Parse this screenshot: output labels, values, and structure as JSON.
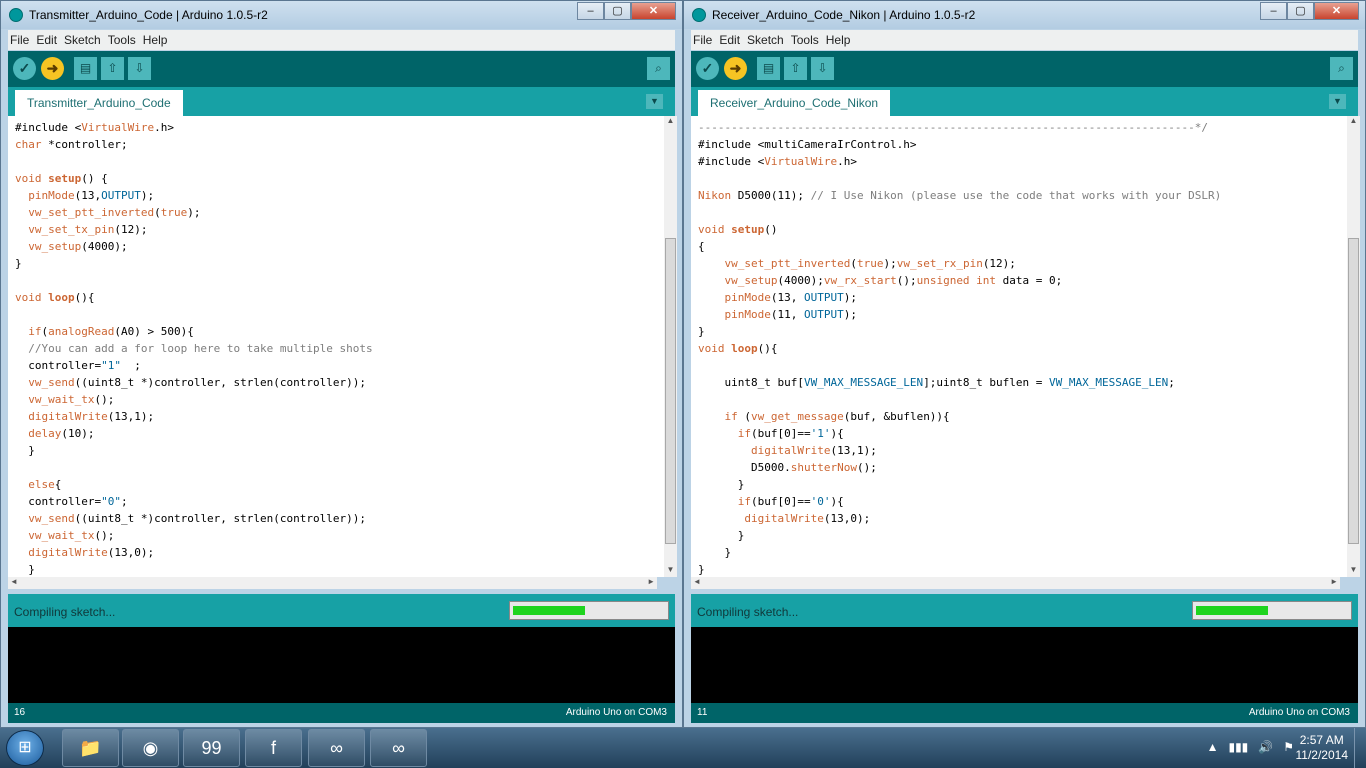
{
  "windows": [
    {
      "title": "Transmitter_Arduino_Code | Arduino 1.0.5-r2",
      "menu": [
        "File",
        "Edit",
        "Sketch",
        "Tools",
        "Help"
      ],
      "tab": "Transmitter_Arduino_Code",
      "status": "Compiling sketch...",
      "progress": 0.48,
      "line_number": "16",
      "board": "Arduino Uno on COM3",
      "code": [
        [
          {
            "t": "#include <"
          },
          {
            "t": "VirtualWire",
            "c": "c-kw"
          },
          {
            "t": ".h>"
          }
        ],
        [
          {
            "t": "char",
            "c": "c-kw"
          },
          {
            "t": " *controller;"
          }
        ],
        [
          {
            "t": ""
          }
        ],
        [
          {
            "t": "void",
            "c": "c-kw"
          },
          {
            "t": " "
          },
          {
            "t": "setup",
            "c": "c-bold"
          },
          {
            "t": "() {"
          }
        ],
        [
          {
            "t": "  "
          },
          {
            "t": "pinMode",
            "c": "c-func"
          },
          {
            "t": "(13,"
          },
          {
            "t": "OUTPUT",
            "c": "c-const"
          },
          {
            "t": ");"
          }
        ],
        [
          {
            "t": "  "
          },
          {
            "t": "vw_set_ptt_inverted",
            "c": "c-func"
          },
          {
            "t": "("
          },
          {
            "t": "true",
            "c": "c-kw"
          },
          {
            "t": ");"
          }
        ],
        [
          {
            "t": "  "
          },
          {
            "t": "vw_set_tx_pin",
            "c": "c-func"
          },
          {
            "t": "(12);"
          }
        ],
        [
          {
            "t": "  "
          },
          {
            "t": "vw_setup",
            "c": "c-func"
          },
          {
            "t": "(4000);"
          }
        ],
        [
          {
            "t": "}"
          }
        ],
        [
          {
            "t": ""
          }
        ],
        [
          {
            "t": "void",
            "c": "c-kw"
          },
          {
            "t": " "
          },
          {
            "t": "loop",
            "c": "c-bold"
          },
          {
            "t": "(){"
          }
        ],
        [
          {
            "t": ""
          }
        ],
        [
          {
            "t": "  "
          },
          {
            "t": "if",
            "c": "c-kw"
          },
          {
            "t": "("
          },
          {
            "t": "analogRead",
            "c": "c-func"
          },
          {
            "t": "(A0) > 500){"
          }
        ],
        [
          {
            "t": "  "
          },
          {
            "t": "//You can add a for loop here to take multiple shots",
            "c": "c-comment"
          }
        ],
        [
          {
            "t": "  controller="
          },
          {
            "t": "\"1\"",
            "c": "c-str"
          },
          {
            "t": "  ;"
          }
        ],
        [
          {
            "t": "  "
          },
          {
            "t": "vw_send",
            "c": "c-func"
          },
          {
            "t": "((uint8_t *)controller, strlen(controller));"
          }
        ],
        [
          {
            "t": "  "
          },
          {
            "t": "vw_wait_tx",
            "c": "c-func"
          },
          {
            "t": "();"
          }
        ],
        [
          {
            "t": "  "
          },
          {
            "t": "digitalWrite",
            "c": "c-func"
          },
          {
            "t": "(13,1);"
          }
        ],
        [
          {
            "t": "  "
          },
          {
            "t": "delay",
            "c": "c-func"
          },
          {
            "t": "(10);"
          }
        ],
        [
          {
            "t": "  }"
          }
        ],
        [
          {
            "t": ""
          }
        ],
        [
          {
            "t": "  "
          },
          {
            "t": "else",
            "c": "c-kw"
          },
          {
            "t": "{"
          }
        ],
        [
          {
            "t": "  controller="
          },
          {
            "t": "\"0\"",
            "c": "c-str"
          },
          {
            "t": ";"
          }
        ],
        [
          {
            "t": "  "
          },
          {
            "t": "vw_send",
            "c": "c-func"
          },
          {
            "t": "((uint8_t *)controller, strlen(controller));"
          }
        ],
        [
          {
            "t": "  "
          },
          {
            "t": "vw_wait_tx",
            "c": "c-func"
          },
          {
            "t": "();"
          }
        ],
        [
          {
            "t": "  "
          },
          {
            "t": "digitalWrite",
            "c": "c-func"
          },
          {
            "t": "(13,0);"
          }
        ],
        [
          {
            "t": "  }"
          }
        ]
      ]
    },
    {
      "title": "Receiver_Arduino_Code_Nikon | Arduino 1.0.5-r2",
      "menu": [
        "File",
        "Edit",
        "Sketch",
        "Tools",
        "Help"
      ],
      "tab": "Receiver_Arduino_Code_Nikon",
      "status": "Compiling sketch...",
      "progress": 0.48,
      "line_number": "11",
      "board": "Arduino Uno on COM3",
      "code": [
        [
          {
            "t": "---------------------------------------------------------------------------*/",
            "c": "c-comment"
          }
        ],
        [
          {
            "t": "#include <multiCameraIrControl.h>"
          }
        ],
        [
          {
            "t": "#include <"
          },
          {
            "t": "VirtualWire",
            "c": "c-kw"
          },
          {
            "t": ".h>"
          }
        ],
        [
          {
            "t": ""
          }
        ],
        [
          {
            "t": "Nikon",
            "c": "c-kw"
          },
          {
            "t": " D5000(11); "
          },
          {
            "t": "// I Use Nikon (please use the code that works with your DSLR)",
            "c": "c-comment"
          }
        ],
        [
          {
            "t": ""
          }
        ],
        [
          {
            "t": "void",
            "c": "c-kw"
          },
          {
            "t": " "
          },
          {
            "t": "setup",
            "c": "c-bold"
          },
          {
            "t": "()"
          }
        ],
        [
          {
            "t": "{"
          }
        ],
        [
          {
            "t": "    "
          },
          {
            "t": "vw_set_ptt_inverted",
            "c": "c-func"
          },
          {
            "t": "("
          },
          {
            "t": "true",
            "c": "c-kw"
          },
          {
            "t": ");"
          },
          {
            "t": "vw_set_rx_pin",
            "c": "c-func"
          },
          {
            "t": "(12);"
          }
        ],
        [
          {
            "t": "    "
          },
          {
            "t": "vw_setup",
            "c": "c-func"
          },
          {
            "t": "(4000);"
          },
          {
            "t": "vw_rx_start",
            "c": "c-func"
          },
          {
            "t": "();"
          },
          {
            "t": "unsigned int",
            "c": "c-kw"
          },
          {
            "t": " data = 0;"
          }
        ],
        [
          {
            "t": "    "
          },
          {
            "t": "pinMode",
            "c": "c-func"
          },
          {
            "t": "(13, "
          },
          {
            "t": "OUTPUT",
            "c": "c-const"
          },
          {
            "t": ");"
          }
        ],
        [
          {
            "t": "    "
          },
          {
            "t": "pinMode",
            "c": "c-func"
          },
          {
            "t": "(11, "
          },
          {
            "t": "OUTPUT",
            "c": "c-const"
          },
          {
            "t": ");"
          }
        ],
        [
          {
            "t": "}"
          }
        ],
        [
          {
            "t": "void",
            "c": "c-kw"
          },
          {
            "t": " "
          },
          {
            "t": "loop",
            "c": "c-bold"
          },
          {
            "t": "(){"
          }
        ],
        [
          {
            "t": ""
          }
        ],
        [
          {
            "t": "    uint8_t buf["
          },
          {
            "t": "VW_MAX_MESSAGE_LEN",
            "c": "c-const"
          },
          {
            "t": "];uint8_t buflen = "
          },
          {
            "t": "VW_MAX_MESSAGE_LEN",
            "c": "c-const"
          },
          {
            "t": ";"
          }
        ],
        [
          {
            "t": ""
          }
        ],
        [
          {
            "t": "    "
          },
          {
            "t": "if",
            "c": "c-kw"
          },
          {
            "t": " ("
          },
          {
            "t": "vw_get_message",
            "c": "c-func"
          },
          {
            "t": "(buf, &buflen)){"
          }
        ],
        [
          {
            "t": "      "
          },
          {
            "t": "if",
            "c": "c-kw"
          },
          {
            "t": "(buf[0]=="
          },
          {
            "t": "'1'",
            "c": "c-str"
          },
          {
            "t": "){"
          }
        ],
        [
          {
            "t": "        "
          },
          {
            "t": "digitalWrite",
            "c": "c-func"
          },
          {
            "t": "(13,1);"
          }
        ],
        [
          {
            "t": "        D5000."
          },
          {
            "t": "shutterNow",
            "c": "c-func"
          },
          {
            "t": "();"
          }
        ],
        [
          {
            "t": "      }"
          }
        ],
        [
          {
            "t": "      "
          },
          {
            "t": "if",
            "c": "c-kw"
          },
          {
            "t": "(buf[0]=="
          },
          {
            "t": "'0'",
            "c": "c-str"
          },
          {
            "t": "){"
          }
        ],
        [
          {
            "t": "       "
          },
          {
            "t": "digitalWrite",
            "c": "c-func"
          },
          {
            "t": "(13,0);"
          }
        ],
        [
          {
            "t": "      }"
          }
        ],
        [
          {
            "t": "    }"
          }
        ],
        [
          {
            "t": "}"
          }
        ]
      ]
    }
  ],
  "taskbar": {
    "start_label": "⊞",
    "items": [
      {
        "name": "explorer",
        "glyph": "📁"
      },
      {
        "name": "chrome",
        "glyph": "◉"
      },
      {
        "name": "99",
        "glyph": "99"
      },
      {
        "name": "foxit",
        "glyph": "f"
      },
      {
        "name": "arduino-1",
        "glyph": "∞"
      },
      {
        "name": "arduino-2",
        "glyph": "∞"
      }
    ],
    "tray_icons": [
      "▲",
      "▮▮▮",
      "🔊",
      "⚑"
    ],
    "time": "2:57 AM",
    "date": "11/2/2014"
  },
  "colors": {
    "toolbar": "#006468",
    "tabbar": "#17a1a5",
    "keyword": "#cc6633",
    "constant": "#006699",
    "comment": "#7e7e7e",
    "progress": "#1ed41e"
  }
}
